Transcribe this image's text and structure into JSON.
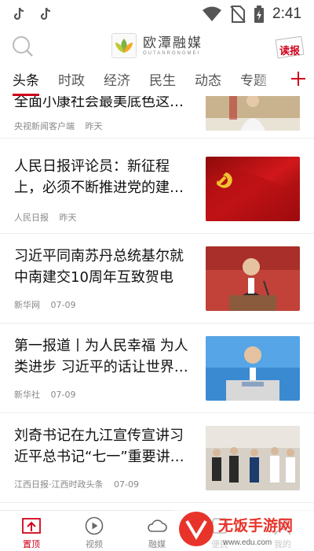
{
  "status": {
    "time": "2:41"
  },
  "header": {
    "logo_name": "欧潭融媒",
    "logo_sub": "OUTANRONGMEI",
    "read_label": "读报"
  },
  "tabs": [
    "头条",
    "时政",
    "经济",
    "民生",
    "动态",
    "专题"
  ],
  "news": [
    {
      "title": "全面小康社会最美底色这…",
      "source": "央视新闻客户端",
      "time": "昨天"
    },
    {
      "title": "人民日报评论员：新征程上，必须不断推进党的建…",
      "source": "人民日报",
      "time": "昨天"
    },
    {
      "title": "习近平同南苏丹总统基尔就中南建交10周年互致贺电",
      "source": "新华网",
      "time": "07-09"
    },
    {
      "title": "第一报道丨为人民幸福 为人类进步 习近平的话让世界…",
      "source": "新华社",
      "time": "07-09"
    },
    {
      "title": "刘奇书记在九江宣传宣讲习近平总书记“七一”重要讲…",
      "source": "江西日报·江西时政头条",
      "time": "07-09"
    }
  ],
  "bottom_nav": [
    "置顶",
    "视频",
    "融媒",
    "便民",
    "我的"
  ],
  "watermark": {
    "text": "无饭手游网",
    "url": "www.edu.com"
  },
  "colors": {
    "accent": "#d0021b",
    "muted": "#888888"
  }
}
